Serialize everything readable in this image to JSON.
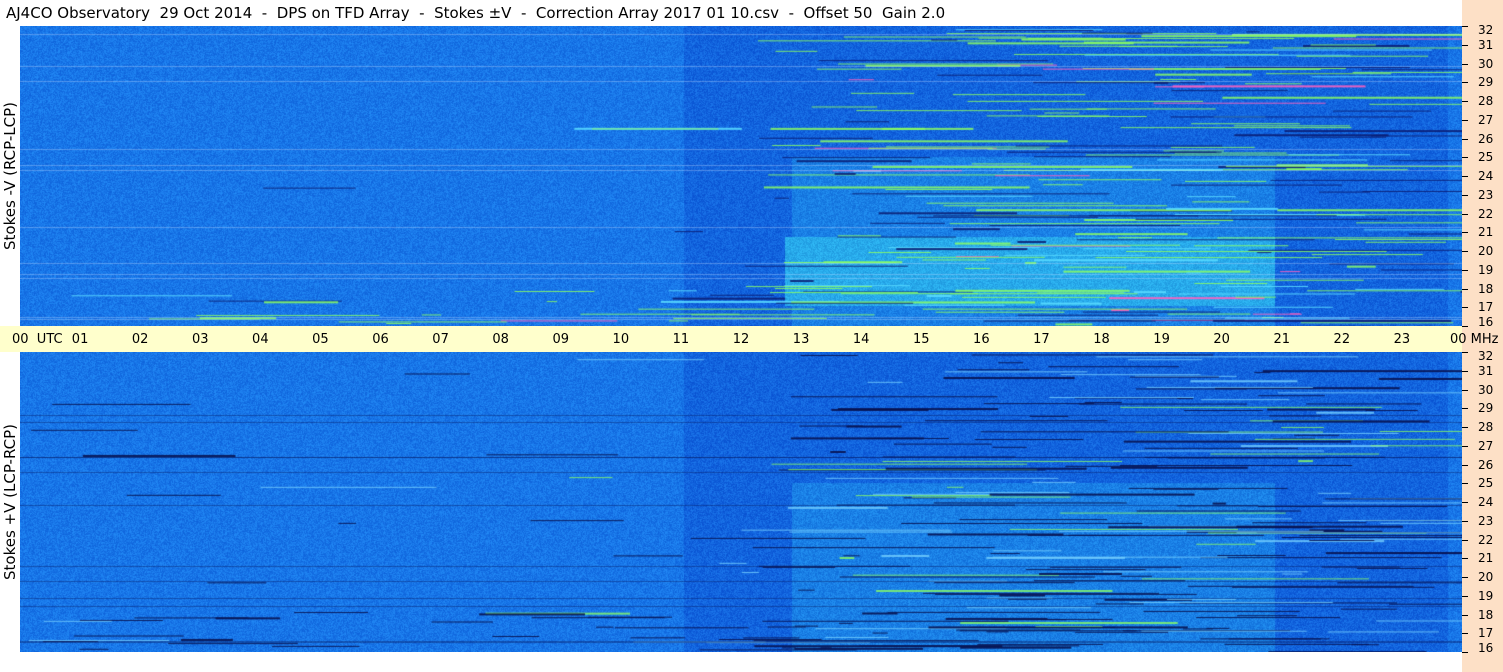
{
  "title": "AJ4CO Observatory  29 Oct 2014  -  DPS on TFD Array  -  Stokes ±V  -  Correction Array 2017 01 10.csv  -  Offset 50  Gain 2.0",
  "chart_data": {
    "type": "heatmap",
    "title": "AJ4CO Observatory  29 Oct 2014  -  DPS on TFD Array  -  Stokes ±V  -  Correction Array 2017 01 10.csv  -  Offset 50  Gain 2.0",
    "x_label": "UTC",
    "y_unit": "MHz",
    "x_ticks": [
      "00",
      "01",
      "02",
      "03",
      "04",
      "05",
      "06",
      "07",
      "08",
      "09",
      "10",
      "11",
      "12",
      "13",
      "14",
      "15",
      "16",
      "17",
      "18",
      "19",
      "20",
      "21",
      "22",
      "23",
      "00"
    ],
    "xlim": [
      0,
      24
    ],
    "ylim": [
      16,
      32
    ],
    "y_ticks": [
      "16",
      "17",
      "18",
      "19",
      "20",
      "21",
      "22",
      "23",
      "24",
      "25",
      "26",
      "27",
      "28",
      "29",
      "30",
      "31",
      "32"
    ],
    "panels": [
      {
        "name": "top",
        "ylabel": "Stokes -V (RCP-LCP)",
        "mode": "bright"
      },
      {
        "name": "bottom",
        "ylabel": "Stokes +V (LCP-RCP)",
        "mode": "dark"
      }
    ],
    "colors": {
      "base": "#1a7ae8",
      "dark": "#0a1a6e",
      "bright": "#8cff60",
      "hot": "#ff60c0",
      "axis_strip": "#ffffcc",
      "right_axis": "#fde0c6"
    }
  }
}
